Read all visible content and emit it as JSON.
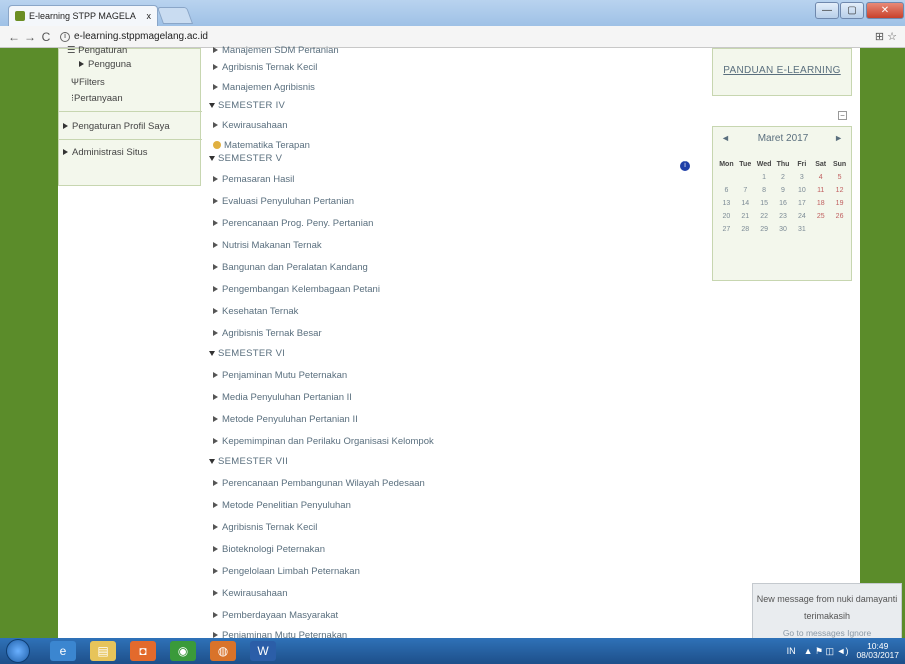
{
  "browser": {
    "tab_title": "E-learning STPP MAGELA",
    "tab_close": "x",
    "url": "e-learning.stppmagelang.ac.id",
    "back_icon": "←",
    "forward_icon": "→",
    "reload_icon": "C",
    "info_icon": "i",
    "translate_icon": "⊞",
    "star_icon": "☆",
    "window": {
      "min": "—",
      "max": "▢",
      "close": "✕"
    }
  },
  "left_block": {
    "items": [
      {
        "label": "Pengaturan"
      },
      {
        "label": "Pengguna"
      },
      {
        "label": "Filters"
      },
      {
        "label": "Pertanyaan"
      },
      {
        "label": "Pengaturan Profil Saya"
      },
      {
        "label": "Administrasi Situs"
      }
    ]
  },
  "courses": {
    "top": [
      "Manajemen SDM Pertanian",
      "Agribisnis Ternak Kecil",
      "Manajemen Agribisnis"
    ],
    "sem4_label": "SEMESTER IV",
    "sem4": [
      "Kewirausahaan",
      "Matematika Terapan"
    ],
    "sem5_label": "SEMESTER V",
    "sem5": [
      "Pemasaran Hasil",
      "Evaluasi Penyuluhan Pertanian",
      "Perencanaan Prog. Peny. Pertanian",
      "Nutrisi Makanan Ternak",
      "Bangunan dan Peralatan Kandang",
      "Pengembangan Kelembagaan Petani",
      "Kesehatan Ternak",
      "Agribisnis Ternak Besar"
    ],
    "sem6_label": "SEMESTER VI",
    "sem6": [
      "Penjaminan Mutu Peternakan",
      "Media Penyuluhan Pertanian II",
      "Metode Penyuluhan Pertanian II",
      "Kepemimpinan dan Perilaku Organisasi Kelompok"
    ],
    "sem7_label": "SEMESTER VII",
    "sem7": [
      "Perencanaan Pembangunan Wilayah Pedesaan",
      "Metode Penelitian Penyuluhan",
      "Agribisnis Ternak Kecil",
      "Bioteknologi Peternakan",
      "Pengelolaan Limbah Peternakan",
      "Kewirausahaan",
      "Pemberdayaan Masyarakat",
      "Penjaminan Mutu Peternakan"
    ],
    "info_badge": "i"
  },
  "guide": {
    "label": "PANDUAN E-LEARNING"
  },
  "collapse_label": "−",
  "calendar": {
    "month": "Maret 2017",
    "prev": "◄",
    "next": "►",
    "dow": [
      "Mon",
      "Tue",
      "Wed",
      "Thu",
      "Fri",
      "Sat",
      "Sun"
    ],
    "weeks": [
      [
        "",
        "",
        "1",
        "2",
        "3",
        "4",
        "5"
      ],
      [
        "6",
        "7",
        "8",
        "9",
        "10",
        "11",
        "12"
      ],
      [
        "13",
        "14",
        "15",
        "16",
        "17",
        "18",
        "19"
      ],
      [
        "20",
        "21",
        "22",
        "23",
        "24",
        "25",
        "26"
      ],
      [
        "27",
        "28",
        "29",
        "30",
        "31",
        "",
        ""
      ]
    ]
  },
  "notification": {
    "title": "New message from nuki damayanti",
    "message": "terimakasih",
    "action_goto": "Go to messages",
    "action_ignore": "Ignore"
  },
  "taskbar": {
    "lang": "IN",
    "time": "10:49",
    "date": "08/03/2017",
    "tray_icons": "▲ ⚑ ◫ ◄)"
  }
}
